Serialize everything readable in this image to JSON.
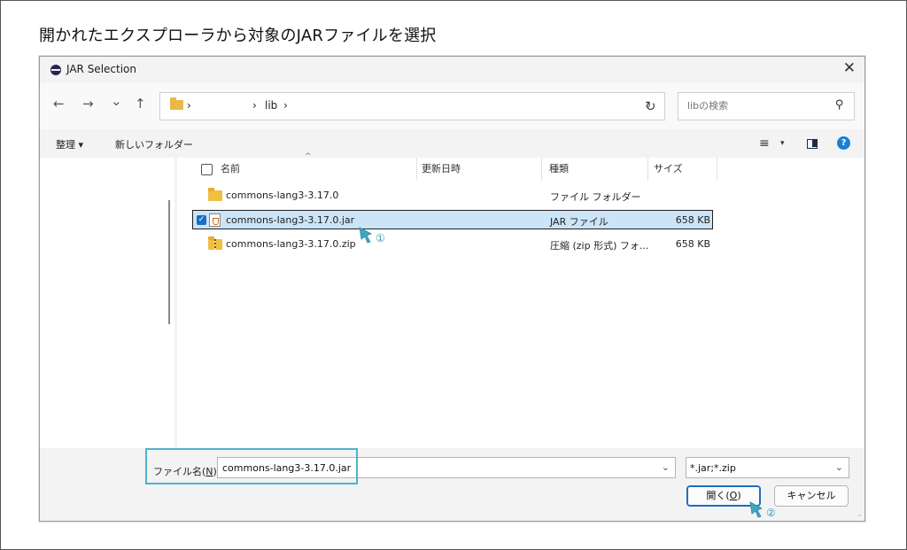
{
  "caption": "開かれたエクスプローラから対象のJARファイルを選択",
  "dialog": {
    "title": "JAR Selection",
    "close_glyph": "✕"
  },
  "nav": {
    "back_glyph": "←",
    "forward_glyph": "→",
    "recent_glyph": "⌄",
    "up_glyph": "↑",
    "crumb_sep1": "›",
    "crumb_folder": "lib",
    "crumb_sep2": "›",
    "crumb_sep3": "›",
    "dropdown_glyph": "⌄",
    "refresh_glyph": "↻",
    "search_placeholder": "libの検索",
    "search_glyph": "⚲"
  },
  "toolbar": {
    "organize": "整理 ▾",
    "new_folder": "新しいフォルダー",
    "view_glyph": "≡",
    "view_dd": "▾",
    "help_glyph": "?"
  },
  "columns": {
    "name": "名前",
    "modified": "更新日時",
    "type": "種類",
    "size": "サイズ",
    "sort_glyph": "^"
  },
  "files": [
    {
      "name": "commons-lang3-3.17.0",
      "type": "ファイル フォルダー",
      "size": "",
      "icon": "folder-icon"
    },
    {
      "name": "commons-lang3-3.17.0.jar",
      "type": "JAR ファイル",
      "size": "658 KB",
      "icon": "jar-file-icon"
    },
    {
      "name": "commons-lang3-3.17.0.zip",
      "type": "圧縮 (zip 形式) フォ...",
      "size": "658 KB",
      "icon": "zip-folder-icon"
    }
  ],
  "checkmark": "✓",
  "bottom": {
    "filename_label": "ファイル名(",
    "filename_key": "N",
    "filename_label_end": "):",
    "filename_value": "commons-lang3-3.17.0.jar",
    "filter_value": "*.jar;*.zip",
    "dropdown_glyph": "⌄",
    "open_label": "開く(",
    "open_key": "O",
    "open_label_end": ")",
    "cancel_label": "キャンセル",
    "grip_glyph": "⠤"
  },
  "annotations": {
    "step1": "①",
    "step2": "②",
    "accent_color": "#4fb2cc"
  }
}
